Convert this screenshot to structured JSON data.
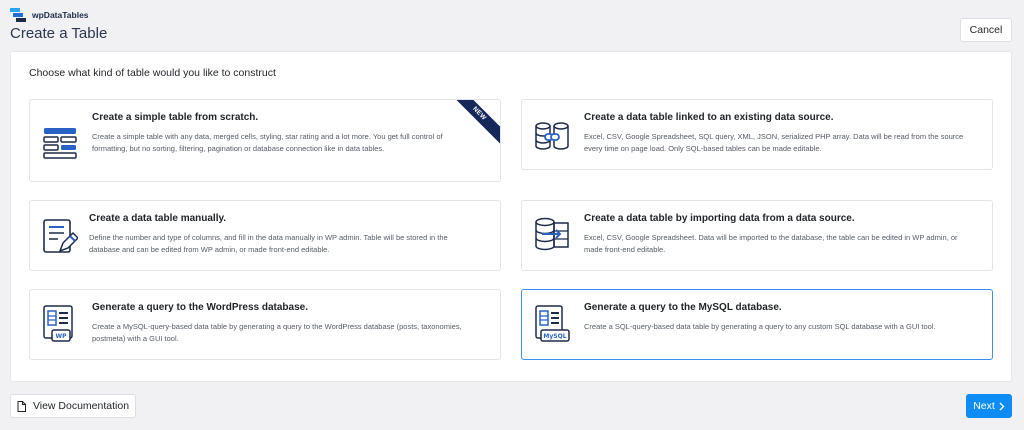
{
  "brand": {
    "name": "wpDataTables",
    "logo_icon": "wpdatatables-logo-icon"
  },
  "page": {
    "title": "Create a Table"
  },
  "header": {
    "cancel_label": "Cancel"
  },
  "panel": {
    "heading": "Choose what kind of table would you like to construct",
    "cards": [
      {
        "title": "Create a simple table from scratch.",
        "description": "Create a simple table with any data, merged cells, styling, star rating and a lot more. You get full control of formatting, but no sorting, filtering, pagination or database connection like in data tables.",
        "icon": "simple-table-icon",
        "badge": "NEW",
        "selected": false
      },
      {
        "title": "Create a data table linked to an existing data source.",
        "description": "Excel, CSV, Google Spreadsheet, SQL query, XML, JSON, serialized PHP array. Data will be read from the source every time on page load. Only SQL-based tables can be made editable.",
        "icon": "linked-data-source-icon",
        "selected": false
      },
      {
        "title": "Create a data table manually.",
        "description": "Define the number and type of columns, and fill in the data manually in WP admin. Table will be stored in the database and can be edited from WP admin, or made front-end editable.",
        "icon": "manual-table-icon",
        "selected": false
      },
      {
        "title": "Create a data table by importing data from a data source.",
        "description": "Excel, CSV, Google Spreadsheet. Data will be imported to the database, the table can be edited in WP admin, or made front-end editable.",
        "icon": "import-data-icon",
        "selected": false
      },
      {
        "title": "Generate a query to the WordPress database.",
        "description": "Create a MySQL-query-based data table by generating a query to the WordPress database (posts, taxonomies, postmeta) with a GUI tool.",
        "icon": "wordpress-query-icon",
        "icon_label": "WP",
        "selected": false
      },
      {
        "title": "Generate a query to the MySQL database.",
        "description": "Create a SQL-query-based data table by generating a query to any custom SQL database with a GUI tool.",
        "icon": "mysql-query-icon",
        "icon_label": "MySQL",
        "selected": true
      }
    ]
  },
  "footer": {
    "doc_label": "View Documentation",
    "doc_icon": "document-icon",
    "next_label": "Next",
    "next_icon": "chevron-right-icon"
  },
  "colors": {
    "accent": "#0d8cf4",
    "icon_blue": "#2962c4",
    "icon_navy": "#1d2b4a",
    "ribbon": "#16275a",
    "selected_border": "#3a8ef6"
  }
}
